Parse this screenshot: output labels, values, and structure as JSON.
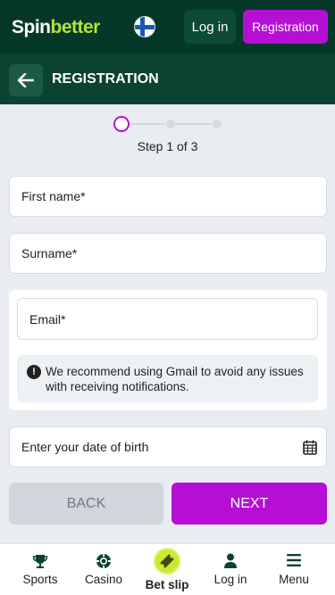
{
  "header": {
    "logo_part1": "Spin",
    "logo_part2": "better",
    "language_flag": "finland-flag",
    "login_label": "Log in",
    "registration_label": "Registration"
  },
  "page": {
    "back_icon": "arrow-left-icon",
    "title": "REGISTRATION"
  },
  "stepper": {
    "current": 1,
    "total": 3,
    "label": "Step 1 of 3"
  },
  "form": {
    "first_name_label": "First name*",
    "surname_label": "Surname*",
    "email_label": "Email*",
    "email_notice": "We recommend using Gmail to avoid any issues with receiving notifications.",
    "dob_label": "Enter your date of birth",
    "dob_icon": "calendar-icon",
    "back_label": "BACK",
    "next_label": "NEXT"
  },
  "bottom_nav": {
    "items": [
      {
        "label": "Sports",
        "icon": "trophy-icon"
      },
      {
        "label": "Casino",
        "icon": "casino-chip-icon"
      },
      {
        "label": "Bet slip",
        "icon": "ticket-icon"
      },
      {
        "label": "Log in",
        "icon": "user-icon"
      },
      {
        "label": "Menu",
        "icon": "menu-icon"
      }
    ]
  },
  "colors": {
    "topbar_bg": "#06382a",
    "header_bg": "#0b4232",
    "accent_purple": "#b50fd6",
    "logo_green": "#b4e23a",
    "betslip_yellow": "#c9ea2f",
    "page_bg": "#e9edf1"
  }
}
